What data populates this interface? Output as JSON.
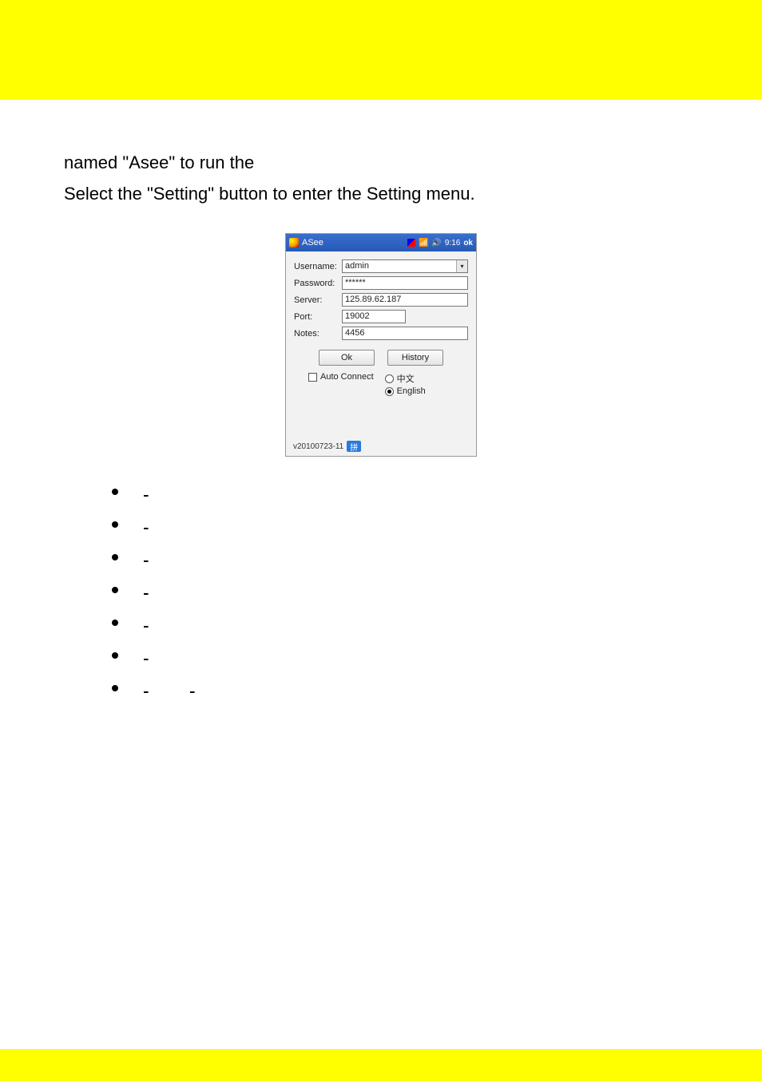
{
  "intro": {
    "line1": "named \"Asee\" to run the",
    "line2": "Select the \"Setting\" button to enter the Setting menu."
  },
  "asee": {
    "title": "ASee",
    "status_time": "9:16",
    "status_ok": "ok",
    "labels": {
      "username": "Username:",
      "password": "Password:",
      "server": "Server:",
      "port": "Port:",
      "notes": "Notes:"
    },
    "values": {
      "username": "admin",
      "password": "******",
      "server": "125.89.62.187",
      "port": "19002",
      "notes": "4456"
    },
    "buttons": {
      "ok": "Ok",
      "history": "History"
    },
    "opts": {
      "auto_connect": "Auto Connect",
      "lang_cn": "中文",
      "lang_en": "English",
      "selected_lang": "en"
    },
    "version": "v20100723-11",
    "chip": "拼"
  },
  "defs": {
    "username": {
      "term_w": 100
    },
    "password": {
      "term_w": 100
    },
    "server": {
      "term_w": 70
    },
    "port": {
      "term_w": 45
    },
    "notes": {
      "term_w": 60
    },
    "ok": {
      "term_w": 30
    },
    "auto_connect": {
      "term1_w": 50,
      "term2_w": 90
    }
  }
}
